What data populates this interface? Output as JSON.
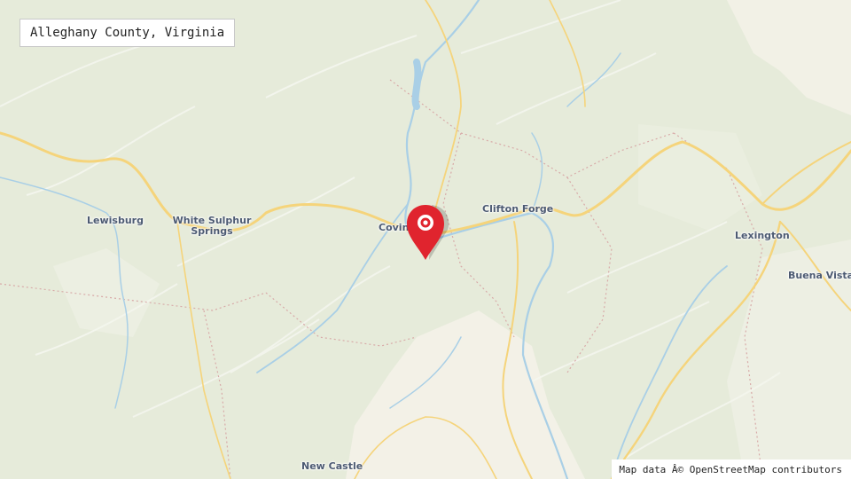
{
  "map": {
    "title": "Alleghany County, Virginia",
    "attribution": "Map data Â© OpenStreetMap contributors",
    "places": {
      "lewisburg": "Lewisburg",
      "white_sulphur_springs_line1": "White Sulphur",
      "white_sulphur_springs_line2": "Springs",
      "covington": "Coving",
      "clifton_forge": "Clifton Forge",
      "lexington": "Lexington",
      "buena_vista": "Buena Vista",
      "new_castle": "New Castle"
    },
    "marker": {
      "icon": "map-pin-icon",
      "color": "#e0242e"
    },
    "colors": {
      "forest": "#e4e9d8",
      "valley": "#f3f1e6",
      "road": "#f6d77e",
      "water": "#a9cfe6",
      "border": "#d9b0b0"
    }
  }
}
